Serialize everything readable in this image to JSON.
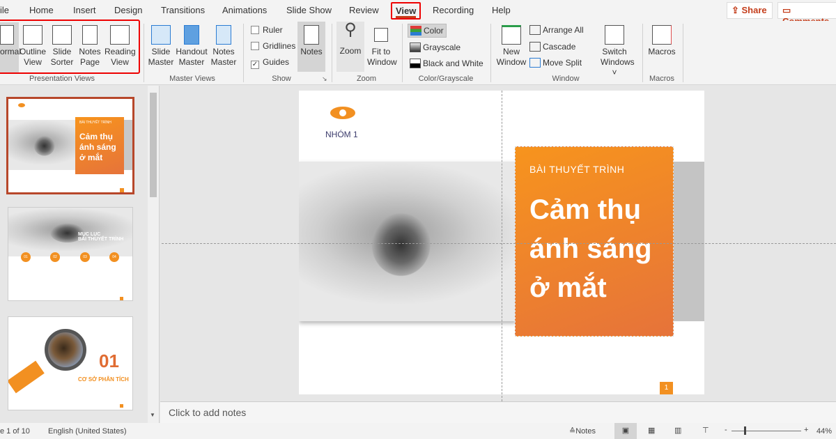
{
  "tabs": [
    "ile",
    "Home",
    "Insert",
    "Design",
    "Transitions",
    "Animations",
    "Slide Show",
    "Review",
    "View",
    "Recording",
    "Help"
  ],
  "active_tab": "View",
  "share": "Share",
  "comments": "Comments",
  "ribbon": {
    "presentation_views": {
      "label": "Presentation Views",
      "buttons": [
        "ormal",
        "Outline View",
        "Slide Sorter",
        "Notes Page",
        "Reading View"
      ]
    },
    "master_views": {
      "label": "Master Views",
      "buttons": [
        "Slide Master",
        "Handout Master",
        "Notes Master"
      ]
    },
    "show": {
      "label": "Show",
      "ruler": "Ruler",
      "gridlines": "Gridlines",
      "guides": "Guides",
      "notes": "Notes",
      "ruler_checked": false,
      "gridlines_checked": false,
      "guides_checked": true
    },
    "zoom": {
      "label": "Zoom",
      "zoom": "Zoom",
      "fit": "Fit to Window"
    },
    "color": {
      "label": "Color/Grayscale",
      "items": [
        "Color",
        "Grayscale",
        "Black and White"
      ]
    },
    "window": {
      "label": "Window",
      "new": "New Window",
      "arrange": "Arrange All",
      "cascade": "Cascade",
      "split": "Move Split",
      "switch": "Switch Windows ˅"
    },
    "macros": {
      "label": "Macros",
      "macros": "Macros"
    }
  },
  "slide": {
    "group": "NHÓM 1",
    "kicker": "BÀI THUYẾT TRÌNH",
    "title1": "Cảm thụ",
    "title2": "ánh sáng",
    "title3": "ở mắt",
    "page": "1"
  },
  "thumbs": {
    "t2_title1": "MỤC LỤC",
    "t2_title2": "BÀI THUYẾT TRÌNH",
    "t2_nums": [
      "01",
      "02",
      "03",
      "04"
    ],
    "t3_num": "01",
    "t3_title": "CƠ SỞ PHÂN TÍCH"
  },
  "notes_placeholder": "Click to add notes",
  "status": {
    "slide": "e 1 of 10",
    "language": "English (United States)",
    "notes": "Notes",
    "zoom": "44%",
    "zoom_fraction": 0.44
  }
}
